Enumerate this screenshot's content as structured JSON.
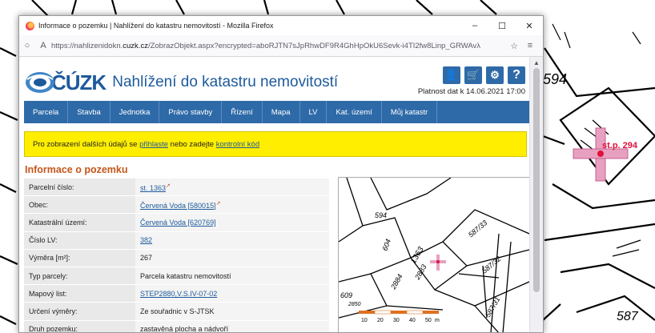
{
  "window": {
    "title": "Informace o pozemku | Nahlížení do katastru nemovitostí - Mozilla Firefox",
    "controls": {
      "minimize": "–",
      "maximize": "☐",
      "close": "✕"
    }
  },
  "browser": {
    "url_prefix": "https://nahlizenidokn.",
    "url_domain": "cuzk.cz",
    "url_rest": "/ZobrazObjekt.aspx?encrypted=aboRJTN7sJpRhwDF9R4GhHpOkU6Sevk-i4TI2fw8Linp_GRWAvλ",
    "bookmark_icon": "☆",
    "menu_icon": "≡",
    "shield_icon": "○",
    "lock_icon": "A"
  },
  "header": {
    "logo_text": "ČÚZK",
    "site_title": "Nahlížení do katastru nemovitostí",
    "validity": "Platnost dat k 14.06.2021 17:00",
    "tools": [
      {
        "name": "user-icon",
        "glyph": "👤"
      },
      {
        "name": "cart-icon",
        "glyph": "🛒"
      },
      {
        "name": "settings-icon",
        "glyph": "⚙"
      },
      {
        "name": "help-icon",
        "glyph": "?"
      }
    ]
  },
  "menu": [
    "Parcela",
    "Stavba",
    "Jednotka",
    "Právo stavby",
    "Řízení",
    "Mapa",
    "LV",
    "Kat. území",
    "Můj katastr"
  ],
  "notice": {
    "before": "Pro zobrazení dalších údajů se ",
    "link1": "přihlaste",
    "middle": " nebo zadejte ",
    "link2": "kontrolní kód"
  },
  "section_title": "Informace o pozemku",
  "rows": [
    {
      "label": "Parcelní číslo:",
      "value": "st. 1363",
      "link": true,
      "ext": true
    },
    {
      "label": "Obec:",
      "value": "Červená Voda [580015]",
      "link": true,
      "ext": true
    },
    {
      "label": "Katastrální území:",
      "value": "Červená Voda [620769]",
      "link": true,
      "ext": false
    },
    {
      "label": "Číslo LV:",
      "value": "382",
      "link": true,
      "ext": false
    },
    {
      "label": "Výměra [m²]:",
      "value": "267",
      "link": false,
      "ext": false
    },
    {
      "label": "Typ parcely:",
      "value": "Parcela katastru nemovitostí",
      "link": false,
      "ext": false
    },
    {
      "label": "Mapový list:",
      "value": "STEP2880,V.S.IV-07-02",
      "link": true,
      "ext": false
    },
    {
      "label": "Určení výměry:",
      "value": "Ze souřadnic v S-JTSK",
      "link": false,
      "ext": false
    },
    {
      "label": "Druh pozemku:",
      "value": "zastavěná plocha a nádvoří",
      "link": false,
      "ext": false
    }
  ],
  "thumb_map": {
    "labels": [
      "594",
      "604",
      "587/33",
      "587/32",
      "587/31",
      "2884",
      "2883",
      "609",
      "1363",
      "2850"
    ],
    "scale_labels": [
      "10",
      "20",
      "30",
      "40",
      "50"
    ],
    "scale_unit": "m"
  },
  "bg_map": {
    "labels": [
      "594",
      "st.p. 294",
      "587"
    ]
  },
  "colors": {
    "brand_blue": "#2e6aa8",
    "notice_yellow": "#ffee00",
    "heading_orange": "#c4561a",
    "marker_pink": "#e8a0c0",
    "marker_red": "#e0103a"
  }
}
